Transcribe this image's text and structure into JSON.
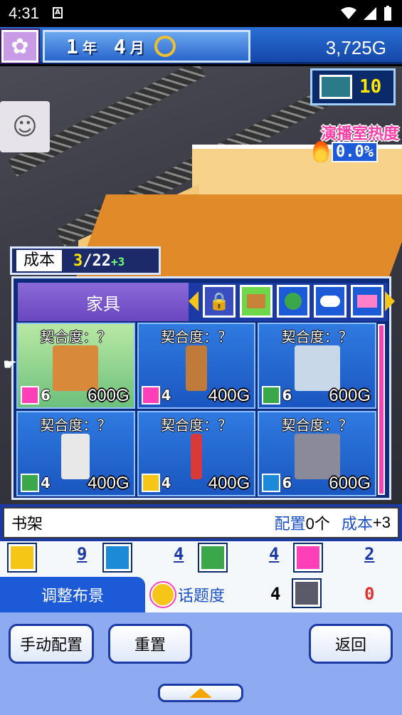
{
  "status_bar": {
    "time": "4:31",
    "app_icon": "A"
  },
  "header": {
    "year": "1",
    "year_unit": "年",
    "month": "4",
    "month_unit": "月",
    "money": "3,725G"
  },
  "hud": {
    "mic_count": "10",
    "heat_label": "演播室热度",
    "heat_value": "0.0%"
  },
  "cost": {
    "label": "成本",
    "current": "3",
    "max": "/22",
    "bonus": "+3"
  },
  "category": {
    "label": "家具",
    "icons": [
      "lock-icon",
      "bookshelf-icon",
      "tree-icon",
      "gamepad-icon",
      "ribbon-icon"
    ]
  },
  "items": [
    {
      "fit": "契合度：？",
      "tag_color": "#ff3fb8",
      "tag_num": "6",
      "price": "600G",
      "selected": true
    },
    {
      "fit": "契合度：？",
      "tag_color": "#ff3fb8",
      "tag_num": "4",
      "price": "400G",
      "selected": false
    },
    {
      "fit": "契合度：？",
      "tag_color": "#3aa84a",
      "tag_num": "6",
      "price": "600G",
      "selected": false
    },
    {
      "fit": "契合度：？",
      "tag_color": "#3aa84a",
      "tag_num": "4",
      "price": "400G",
      "selected": false
    },
    {
      "fit": "契合度：？",
      "tag_color": "#f5c518",
      "tag_num": "4",
      "price": "400G",
      "selected": false
    },
    {
      "fit": "契合度：？",
      "tag_color": "#1c8ad8",
      "tag_num": "6",
      "price": "600G",
      "selected": false
    }
  ],
  "info": {
    "name": "书架",
    "placed_label": "配置",
    "placed_value": "0个",
    "cost_label": "成本",
    "cost_value": "+3"
  },
  "stats": [
    {
      "icon": "smile-icon",
      "color": "#f5c518",
      "value": "9"
    },
    {
      "icon": "speech-icon",
      "color": "#1c8ad8",
      "value": "4"
    },
    {
      "icon": "bell-icon",
      "color": "#3aa84a",
      "value": "4"
    },
    {
      "icon": "tv-icon",
      "color": "#ff3fb8",
      "value": "2"
    }
  ],
  "row2": {
    "tab_label": "调整布景",
    "topic_label": "话题度",
    "neutral_value": "4",
    "alert_value": "0"
  },
  "buttons": {
    "manual": "手动配置",
    "reset": "重置",
    "back": "返回"
  }
}
